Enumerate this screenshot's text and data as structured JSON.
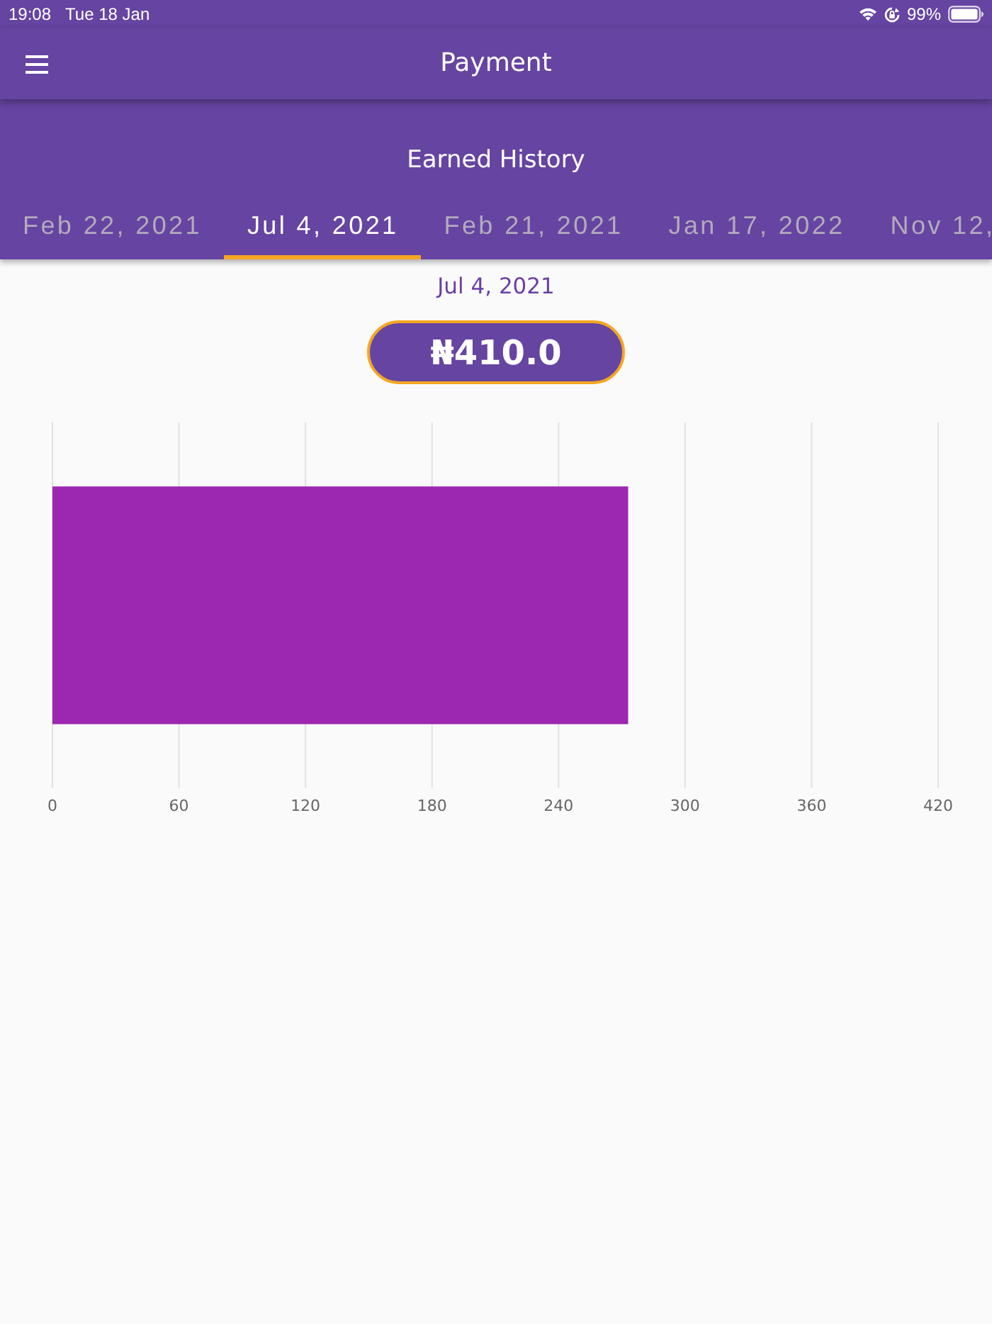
{
  "status_bar": {
    "time": "19:08",
    "date": "Tue 18 Jan",
    "battery": "99%"
  },
  "app_bar": {
    "title": "Payment"
  },
  "history": {
    "title": "Earned History"
  },
  "tabs": [
    {
      "label": "Feb 22, 2021",
      "selected": false
    },
    {
      "label": "Jul 4, 2021",
      "selected": true
    },
    {
      "label": "Feb 21, 2021",
      "selected": false
    },
    {
      "label": "Jan 17, 2022",
      "selected": false
    },
    {
      "label": "Nov 12,",
      "selected": false
    }
  ],
  "selected_date": "Jul 4, 2021",
  "amount": "₦410.0",
  "chart_data": {
    "type": "bar",
    "orientation": "horizontal",
    "grid": true,
    "series": [
      {
        "color": "#9c27b0",
        "values": [
          273
        ]
      }
    ],
    "xlim": [
      0,
      420
    ],
    "xticks": [
      0,
      60,
      120,
      180,
      240,
      300,
      360,
      420
    ]
  }
}
